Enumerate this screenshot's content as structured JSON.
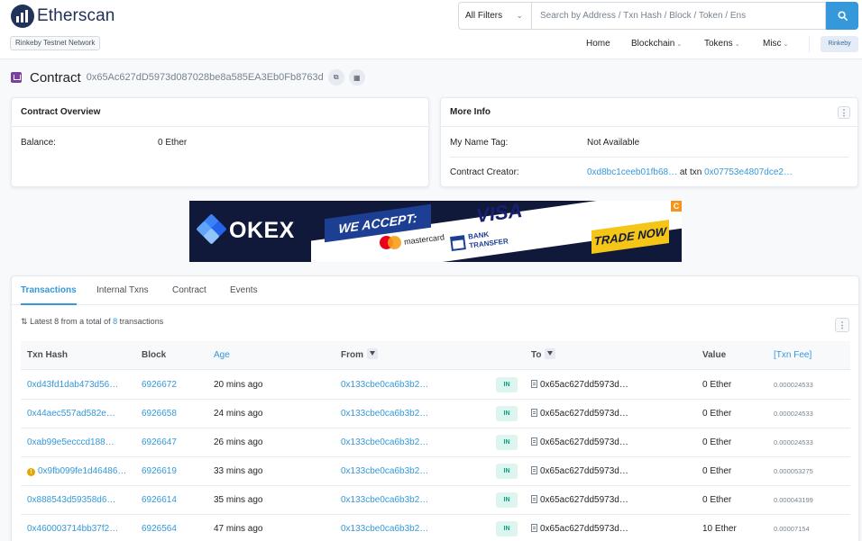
{
  "brand": {
    "name": "Etherscan",
    "network_badge": "Rinkeby Testnet Network"
  },
  "search": {
    "filter_label": "All Filters",
    "placeholder": "Search by Address / Txn Hash / Block / Token / Ens"
  },
  "nav": {
    "home": "Home",
    "blockchain": "Blockchain",
    "tokens": "Tokens",
    "misc": "Misc",
    "network": "Rinkeby"
  },
  "page": {
    "title_label": "Contract",
    "address": "0x65Ac627dD5973d087028be8a585EA3Eb0Fb8763d"
  },
  "overview": {
    "header": "Contract Overview",
    "balance_label": "Balance:",
    "balance_value": "0 Ether"
  },
  "more_info": {
    "header": "More Info",
    "name_tag_label": "My Name Tag:",
    "name_tag_value": "Not Available",
    "creator_label": "Contract Creator:",
    "creator_address": "0xd8bc1ceeb01fb68…",
    "creator_at_txn": "at txn",
    "creator_txn": "0x07753e4807dce2…"
  },
  "ad": {
    "brand": "OKEX",
    "accept": "WE ACCEPT:",
    "mastercard": "mastercard",
    "visa": "VISA",
    "bank_line1": "BANK",
    "bank_line2": "TRANSFER",
    "cta": "TRADE NOW",
    "corner": "C"
  },
  "tabs": [
    {
      "label": "Transactions",
      "active": true
    },
    {
      "label": "Internal Txns",
      "active": false
    },
    {
      "label": "Contract",
      "active": false
    },
    {
      "label": "Events",
      "active": false
    }
  ],
  "summary": {
    "prefix": "Latest 8 from a total of",
    "count": "8",
    "suffix": "transactions"
  },
  "table": {
    "headers": {
      "txn_hash": "Txn Hash",
      "block": "Block",
      "age": "Age",
      "from": "From",
      "to": "To",
      "value": "Value",
      "fee": "[Txn Fee]"
    },
    "rows": [
      {
        "hash": "0xd43fd1dab473d56…",
        "block": "6926672",
        "age": "20 mins ago",
        "from": "0x133cbe0ca6b3b2…",
        "direction": "IN",
        "to": "0x65ac627dd5973d…",
        "value": "0 Ether",
        "fee": "0.000024533",
        "error": false
      },
      {
        "hash": "0x44aec557ad582e…",
        "block": "6926658",
        "age": "24 mins ago",
        "from": "0x133cbe0ca6b3b2…",
        "direction": "IN",
        "to": "0x65ac627dd5973d…",
        "value": "0 Ether",
        "fee": "0.000024533",
        "error": false
      },
      {
        "hash": "0xab99e5ecccd188…",
        "block": "6926647",
        "age": "26 mins ago",
        "from": "0x133cbe0ca6b3b2…",
        "direction": "IN",
        "to": "0x65ac627dd5973d…",
        "value": "0 Ether",
        "fee": "0.000024533",
        "error": false
      },
      {
        "hash": "0x9fb099fe1d46486…",
        "block": "6926619",
        "age": "33 mins ago",
        "from": "0x133cbe0ca6b3b2…",
        "direction": "IN",
        "to": "0x65ac627dd5973d…",
        "value": "0 Ether",
        "fee": "0.000053275",
        "error": true
      },
      {
        "hash": "0x888543d59358d6…",
        "block": "6926614",
        "age": "35 mins ago",
        "from": "0x133cbe0ca6b3b2…",
        "direction": "IN",
        "to": "0x65ac627dd5973d…",
        "value": "0 Ether",
        "fee": "0.000043199",
        "error": false
      },
      {
        "hash": "0x460003714bb37f2…",
        "block": "6926564",
        "age": "47 mins ago",
        "from": "0x133cbe0ca6b3b2…",
        "direction": "IN",
        "to": "0x65ac627dd5973d…",
        "value": "10 Ether",
        "fee": "0.00007154",
        "error": false
      }
    ]
  },
  "colors": {
    "accent": "#3498db",
    "brand_navy": "#21325b",
    "in_badge": "#00a186"
  }
}
